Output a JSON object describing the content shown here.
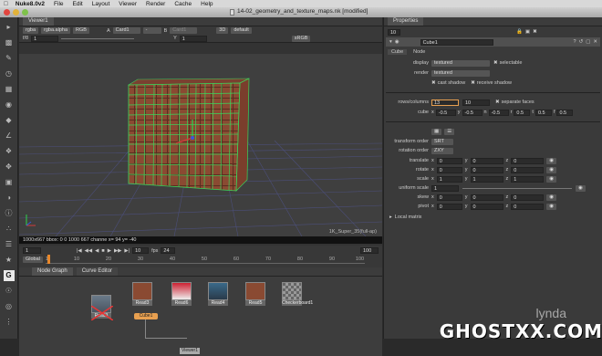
{
  "menubar": {
    "app": "Nuke8.0v2",
    "items": [
      "File",
      "Edit",
      "Layout",
      "Viewer",
      "Render",
      "Cache",
      "Help"
    ]
  },
  "window": {
    "title": "14-02_geometry_and_texture_maps.nk [modified]"
  },
  "viewer": {
    "tab": "Viewer1",
    "channels": "rgba",
    "layer": "rgba.alpha",
    "display_channel": "RGB",
    "input_a_label": "A",
    "input_a": "Card1",
    "input_b_label": "B",
    "input_b": "Card1",
    "view_mode": "3D",
    "camera": "default",
    "lut": "sRGB",
    "fstop": "f/8",
    "frame_field": "1",
    "gain_field": "1",
    "x_field": "Y",
    "y_field": "1",
    "format_label": "1K_Super_35(full-ap)",
    "status": "1000x667  bbox: 0 0 1000 667 channe  x=   94  y=  -40",
    "frame_in": "1",
    "frame_out": "100",
    "current_frame": "10",
    "fps_label": "fps",
    "fps": "24",
    "timeline_mode": "Global",
    "ticks": [
      "1",
      "10",
      "20",
      "30",
      "40",
      "50",
      "60",
      "70",
      "80",
      "90",
      "100"
    ],
    "frame_marker": "1"
  },
  "nodegraph": {
    "tabs": [
      "Node Graph",
      "Curve Editor"
    ],
    "nodes": [
      "Read3",
      "Read3",
      "Read6",
      "Read4",
      "Read5",
      "Checkerboard1"
    ],
    "cube_label": "Cube1",
    "viewer_label": "Viewer1"
  },
  "properties": {
    "tab": "Properties",
    "node_name": "Cube1",
    "subtabs": [
      "Cube",
      "Node"
    ],
    "display_label": "display",
    "display": "textured",
    "selectable": "selectable",
    "render_label": "render",
    "render": "textured",
    "cast_shadow": "cast shadow",
    "receive_shadow": "receive shadow",
    "rows_label": "rows/columns",
    "rows": "13",
    "columns": "10",
    "separate_faces": "separate faces",
    "cube_label": "cube",
    "cube_vals": [
      [
        "x",
        "-0.5"
      ],
      [
        "y",
        "-0.5"
      ],
      [
        "n",
        "-0.5"
      ],
      [
        "r",
        "0.5"
      ],
      [
        "t",
        "0.5"
      ],
      [
        "f",
        "0.5"
      ]
    ],
    "transform_order_label": "transform order",
    "transform_order": "SRT",
    "rotation_order_label": "rotation order",
    "rotation_order": "ZXY",
    "translate_label": "translate",
    "translate": [
      "0",
      "0",
      "0"
    ],
    "rotate_label": "rotate",
    "rotate": [
      "0",
      "0",
      "0"
    ],
    "scale_label": "scale",
    "scale": [
      "1",
      "1",
      "1"
    ],
    "uniform_scale_label": "uniform scale",
    "uniform_scale": "1",
    "skew_label": "skew",
    "skew": [
      "0",
      "0",
      "0"
    ],
    "pivot_label": "pivot",
    "pivot": [
      "0",
      "0",
      "0"
    ],
    "axis_labels": [
      "x",
      "y",
      "z"
    ],
    "local_matrix": "Local matrix"
  },
  "watermark": {
    "lynda": "lynda",
    "brand": "GHOSTXX.COM"
  }
}
